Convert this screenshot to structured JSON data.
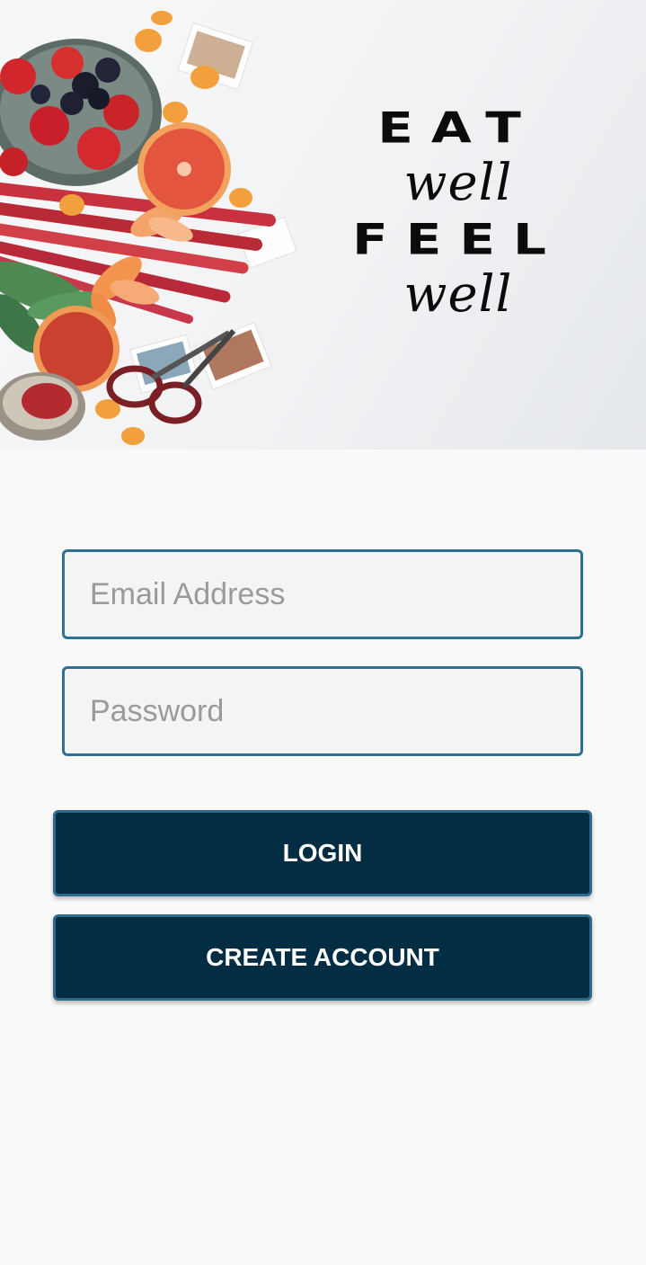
{
  "hero": {
    "slogan_line1": "EAT",
    "slogan_line2": "well",
    "slogan_line3": "FEEL",
    "slogan_line4": "well"
  },
  "form": {
    "email_placeholder": "Email Address",
    "password_placeholder": "Password"
  },
  "buttons": {
    "login_label": "LOGIN",
    "create_account_label": "CREATE ACCOUNT"
  },
  "colors": {
    "button_bg": "#032d42",
    "field_border": "#2e6f94",
    "page_bg": "#f9f9f9"
  }
}
